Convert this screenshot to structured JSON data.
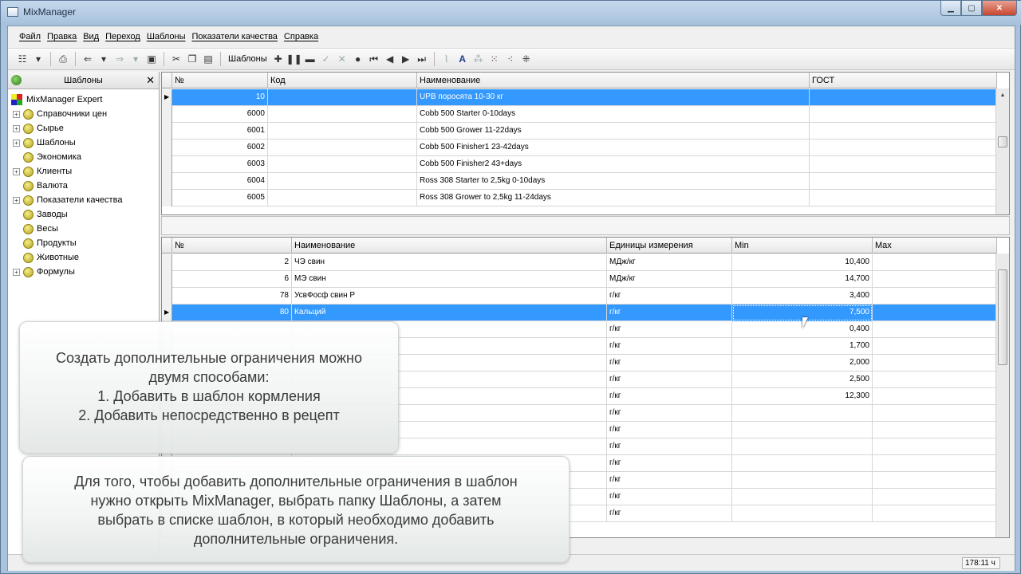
{
  "window": {
    "title": "MixManager"
  },
  "menu": [
    "Файл",
    "Правка",
    "Вид",
    "Переход",
    "Шаблоны",
    "Показатели качества",
    "Справка"
  ],
  "toolbar": {
    "label": "Шаблоны"
  },
  "left_panel": {
    "title": "Шаблоны",
    "root": "MixManager Expert",
    "items": [
      {
        "label": "Справочники цен",
        "expandable": true
      },
      {
        "label": "Сырье",
        "expandable": true
      },
      {
        "label": "Шаблоны",
        "expandable": true
      },
      {
        "label": "Экономика",
        "expandable": false
      },
      {
        "label": "Клиенты",
        "expandable": true
      },
      {
        "label": "Валюта",
        "expandable": false
      },
      {
        "label": "Показатели качества",
        "expandable": true
      },
      {
        "label": "Заводы",
        "expandable": false
      },
      {
        "label": "Весы",
        "expandable": false
      },
      {
        "label": "Продукты",
        "expandable": false
      },
      {
        "label": "Животные",
        "expandable": false
      },
      {
        "label": "Формулы",
        "expandable": true
      }
    ]
  },
  "top_grid": {
    "columns": [
      "№",
      "Код",
      "Наименование",
      "ГОСТ"
    ],
    "rows": [
      {
        "no": "10",
        "code": "",
        "name": "UPB поросята 10-30 кг",
        "gost": "",
        "selected": true
      },
      {
        "no": "6000",
        "code": "",
        "name": "Cobb 500 Starter 0-10days",
        "gost": ""
      },
      {
        "no": "6001",
        "code": "",
        "name": "Cobb 500 Grower 11-22days",
        "gost": ""
      },
      {
        "no": "6002",
        "code": "",
        "name": "Cobb 500 Finisher1 23-42days",
        "gost": ""
      },
      {
        "no": "6003",
        "code": "",
        "name": "Cobb 500 Finisher2 43+days",
        "gost": ""
      },
      {
        "no": "6004",
        "code": "",
        "name": "Ross 308 Starter to 2,5kg 0-10days",
        "gost": ""
      },
      {
        "no": "6005",
        "code": "",
        "name": "Ross 308 Grower to 2,5kg 11-24days",
        "gost": ""
      }
    ]
  },
  "bottom_grid": {
    "columns": [
      "№",
      "Наименование",
      "Единицы измерения",
      "Min",
      "Max"
    ],
    "rows": [
      {
        "no": "2",
        "name": "ЧЭ свин",
        "unit": "МДж/кг",
        "min": "10,400",
        "max": ""
      },
      {
        "no": "6",
        "name": "МЭ свин",
        "unit": "МДж/кг",
        "min": "14,700",
        "max": ""
      },
      {
        "no": "78",
        "name": "УсвФосф свин Р",
        "unit": "г/кг",
        "min": "3,400",
        "max": ""
      },
      {
        "no": "80",
        "name": "Кальций",
        "unit": "г/кг",
        "min": "7,500",
        "max": "",
        "selected": true
      },
      {
        "no": "",
        "name": "",
        "unit": "г/кг",
        "min": "0,400",
        "max": ""
      },
      {
        "no": "",
        "name": "",
        "unit": "г/кг",
        "min": "1,700",
        "max": ""
      },
      {
        "no": "",
        "name": "",
        "unit": "г/кг",
        "min": "2,000",
        "max": ""
      },
      {
        "no": "",
        "name": "",
        "unit": "г/кг",
        "min": "2,500",
        "max": ""
      },
      {
        "no": "",
        "name": "",
        "unit": "г/кг",
        "min": "12,300",
        "max": ""
      },
      {
        "no": "",
        "name": "",
        "unit": "г/кг",
        "min": "",
        "max": ""
      },
      {
        "no": "",
        "name": "",
        "unit": "г/кг",
        "min": "",
        "max": ""
      },
      {
        "no": "",
        "name": "",
        "unit": "г/кг",
        "min": "",
        "max": ""
      },
      {
        "no": "",
        "name": "",
        "unit": "г/кг",
        "min": "",
        "max": ""
      },
      {
        "no": "",
        "name": "",
        "unit": "г/кг",
        "min": "",
        "max": ""
      },
      {
        "no": "",
        "name": "",
        "unit": "г/кг",
        "min": "",
        "max": ""
      },
      {
        "no": "",
        "name": "",
        "unit": "г/кг",
        "min": "",
        "max": ""
      }
    ]
  },
  "status": {
    "time": "178:11 ч"
  },
  "notes": {
    "first": [
      "Создать дополнительные ограничения можно",
      "двумя способами:",
      "1. Добавить в шаблон кормления",
      "2. Добавить непосредственно в рецепт"
    ],
    "second": [
      "Для того, чтобы добавить дополнительные ограничения в шаблон",
      "нужно открыть MixManager, выбрать папку Шаблоны, а затем",
      "выбрать в списке шаблон, в который необходимо добавить",
      "дополнительные ограничения."
    ]
  }
}
